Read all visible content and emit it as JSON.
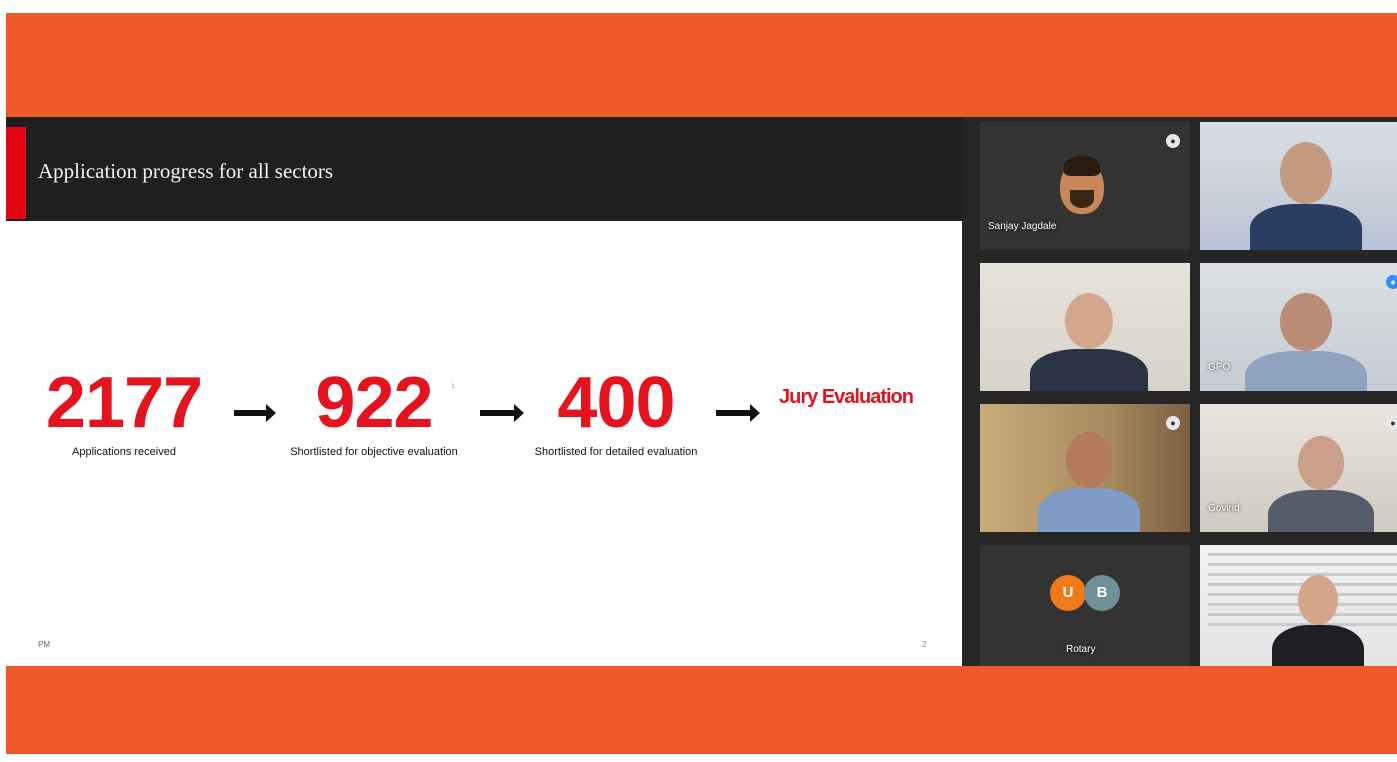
{
  "slide": {
    "title": "Application progress for all sectors",
    "stages": [
      {
        "value": "2177",
        "caption": "Applications received"
      },
      {
        "value": "922",
        "caption": "Shortlisted for objective evaluation"
      },
      {
        "value": "400",
        "caption": "Shortlisted for detailed evaluation"
      },
      {
        "value": "Jury Evaluation",
        "caption": ""
      }
    ],
    "footer_text": "PM",
    "page_number": "2",
    "accent_color": "#e30613",
    "number_color": "#e3141f",
    "header_color": "#1f1f1f"
  },
  "frame": {
    "band_color": "#ef5a2a"
  },
  "gallery": {
    "participants": [
      {
        "name": "Sanjay Jagdale",
        "tile": "avatar-photo"
      },
      {
        "name": "",
        "tile": "video"
      },
      {
        "name": "",
        "tile": "video"
      },
      {
        "name": "GPO",
        "tile": "video"
      },
      {
        "name": "",
        "tile": "video"
      },
      {
        "name": "Govind",
        "tile": "video"
      },
      {
        "name": "Rotary",
        "tile": "avatar-initials",
        "initials": [
          "U",
          "B"
        ]
      },
      {
        "name": "",
        "tile": "video"
      }
    ]
  }
}
